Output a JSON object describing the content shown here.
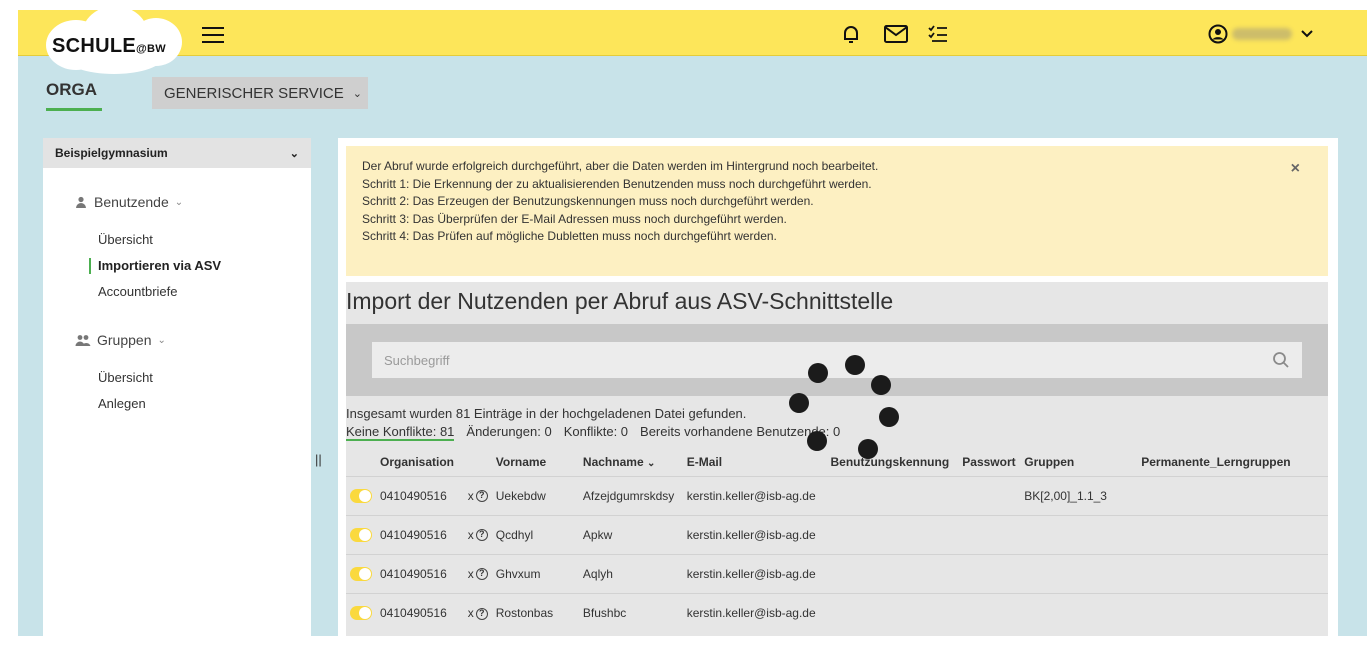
{
  "header": {
    "logo_main": "SCHULE",
    "logo_suffix": "@BW",
    "icons": [
      "menu-icon",
      "bell-icon",
      "mail-icon",
      "checklist-icon",
      "user-circle-icon",
      "chevron-down-icon"
    ],
    "colors": {
      "topbar": "#fde65a",
      "background": "#c8e3e9",
      "accent": "#4caf50",
      "toggle": "#fad93e"
    }
  },
  "subheader": {
    "orga_label": "ORGA",
    "service_label": "GENERISCHER SERVICE"
  },
  "sidebar": {
    "school": "Beispielgymnasium",
    "sections": [
      {
        "label": "Benutzende",
        "items": [
          "Übersicht",
          "Importieren via ASV",
          "Accountbriefe"
        ]
      },
      {
        "label": "Gruppen",
        "items": [
          "Übersicht",
          "Anlegen"
        ]
      }
    ],
    "splitter": "||"
  },
  "alert": {
    "lines": [
      "Der Abruf wurde erfolgreich durchgeführt, aber die Daten werden im Hintergrund noch bearbeitet.",
      "Schritt 1: Die Erkennung der zu aktualisierenden Benutzenden muss noch durchgeführt werden.",
      "Schritt 2: Das Erzeugen der Benutzungskennungen muss noch durchgeführt werden.",
      "Schritt 3: Das Überprüfen der E-Mail Adressen muss noch durchgeführt werden.",
      "Schritt 4: Das Prüfen auf mögliche Dubletten muss noch durchgeführt werden."
    ],
    "close": "×"
  },
  "main": {
    "title": "Import der Nutzenden per Abruf aus ASV-Schnittstelle",
    "search_placeholder": "Suchbegriff",
    "summary": "Insgesamt wurden 81 Einträge in der hochgeladenen Datei gefunden.",
    "filters": [
      "Keine Konflikte: 81",
      "Änderungen: 0",
      "Konflikte: 0",
      "Bereits vorhandene Benutzende: 0"
    ]
  },
  "table": {
    "columns": [
      "Organisation",
      "Vorname",
      "Nachname",
      "E-Mail",
      "Benutzungskennung",
      "Passwort",
      "Gruppen",
      "Permanente_Lerngruppen"
    ],
    "rows": [
      {
        "organisation": "0410490516",
        "x": "x",
        "vorname": "Uekebdw",
        "nachname": "Afzejdgumrskdsy",
        "email": "kerstin.keller@isb-ag.de",
        "gruppen": "BK[2,00]_1.1_3"
      },
      {
        "organisation": "0410490516",
        "x": "x",
        "vorname": "Qcdhyl",
        "nachname": "Apkw",
        "email": "kerstin.keller@isb-ag.de",
        "gruppen": ""
      },
      {
        "organisation": "0410490516",
        "x": "x",
        "vorname": "Ghvxum",
        "nachname": "Aqlyh",
        "email": "kerstin.keller@isb-ag.de",
        "gruppen": ""
      },
      {
        "organisation": "0410490516",
        "x": "x",
        "vorname": "Rostonbas",
        "nachname": "Bfushbc",
        "email": "kerstin.keller@isb-ag.de",
        "gruppen": ""
      }
    ]
  }
}
